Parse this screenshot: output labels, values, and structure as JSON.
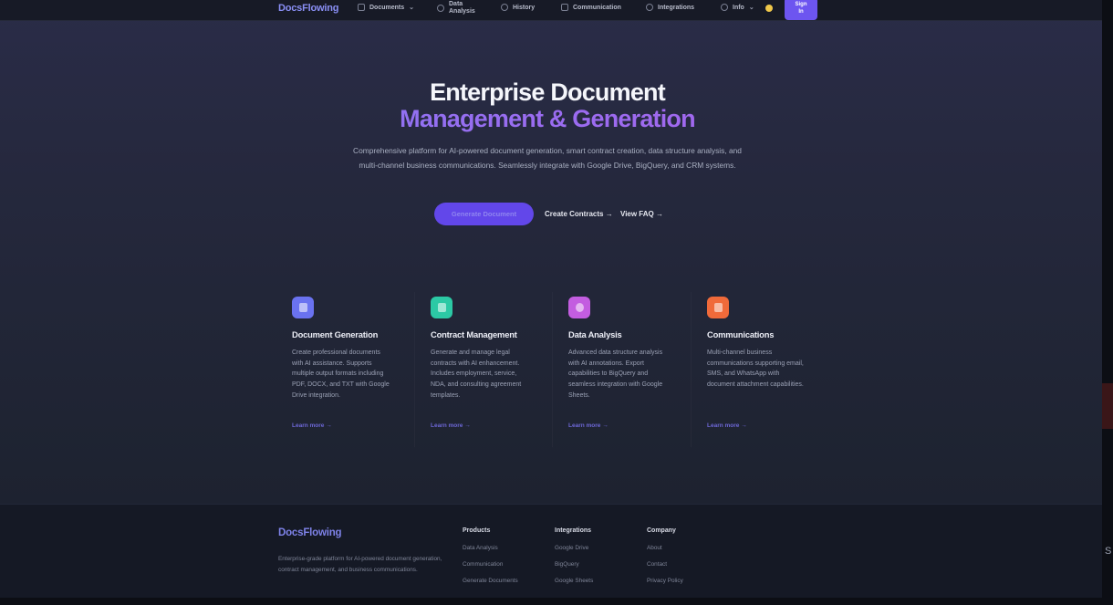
{
  "nav": {
    "logo": "DocsFlowing",
    "items": [
      {
        "label": "Documents",
        "icon": "document-icon",
        "has_chevron": true
      },
      {
        "label_line1": "Data",
        "label_line2": "Analysis",
        "icon": "chart-icon"
      },
      {
        "label": "History",
        "icon": "clock-icon"
      },
      {
        "label": "Communication",
        "icon": "chat-icon"
      },
      {
        "label": "Integrations",
        "icon": "plug-icon"
      },
      {
        "label": "Info",
        "icon": "info-icon",
        "has_chevron": true
      }
    ],
    "theme_toggle_icon": "sun-icon",
    "signin_line1": "Sign",
    "signin_line2": "In"
  },
  "hero": {
    "title_line1": "Enterprise Document",
    "title_line2": "Management & Generation",
    "description": "Comprehensive platform for AI-powered document generation, smart contract creation, data structure analysis, and multi-channel business communications. Seamlessly integrate with Google Drive, BigQuery, and CRM systems.",
    "primary_cta": "Generate Document",
    "secondary_cta": "Create Contracts →",
    "tertiary_cta": "View FAQ →"
  },
  "features": [
    {
      "title": "Document Generation",
      "description": "Create professional documents with AI assistance. Supports multiple output formats including PDF, DOCX, and TXT with Google Drive integration.",
      "link": "Learn more →",
      "icon": "document-icon",
      "color": "#6a72f0"
    },
    {
      "title": "Contract Management",
      "description": "Generate and manage legal contracts with AI enhancement. Includes employment, service, NDA, and consulting agreement templates.",
      "link": "Learn more →",
      "icon": "briefcase-icon",
      "color": "#2cc9a5"
    },
    {
      "title": "Data Analysis",
      "description": "Advanced data structure analysis with AI annotations. Export capabilities to BigQuery and seamless integration with Google Sheets.",
      "link": "Learn more →",
      "icon": "eye-icon",
      "color": "#c35de0"
    },
    {
      "title": "Communications",
      "description": "Multi-channel business communications supporting email, SMS, and WhatsApp with document attachment capabilities.",
      "link": "Learn more →",
      "icon": "mail-icon",
      "color": "#f06a3a"
    }
  ],
  "footer": {
    "logo": "DocsFlowing",
    "description": "Enterprise-grade platform for AI-powered document generation, contract management, and business communications.",
    "columns": [
      {
        "heading": "Products",
        "links": [
          "Data Analysis",
          "Communication",
          "Generate Documents"
        ]
      },
      {
        "heading": "Integrations",
        "links": [
          "Google Drive",
          "BigQuery",
          "Google Sheets"
        ]
      },
      {
        "heading": "Company",
        "links": [
          "About",
          "Contact",
          "Privacy Policy"
        ]
      }
    ]
  },
  "edge_text": "S"
}
